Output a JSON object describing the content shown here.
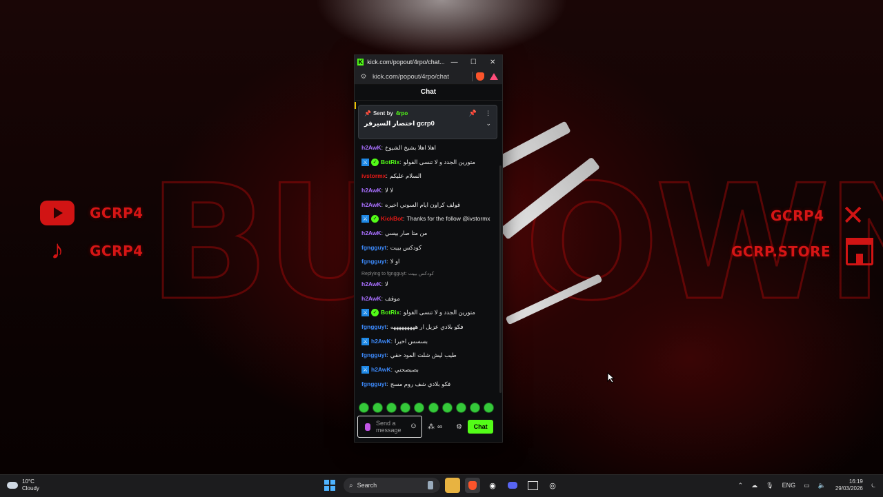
{
  "wallpaper": {
    "social_left": [
      {
        "icon": "youtube-icon",
        "text": "GCRP4"
      },
      {
        "icon": "tiktok-icon",
        "text": "GCRP4"
      }
    ],
    "social_right": [
      {
        "icon": "x-icon",
        "text": "GCRP4"
      },
      {
        "icon": "store-icon",
        "text": "GCRP.STORE"
      }
    ],
    "accent_color": "#d11414"
  },
  "window": {
    "title": "kick.com/popout/4rpo/chat...",
    "url": "kick.com/popout/4rpo/chat",
    "chat_header": "Chat",
    "pinned": {
      "sent_by_label": "Sent by",
      "user": "4rpo",
      "message": "اختصار السيرفر gcrp0"
    },
    "messages": [
      {
        "user": "h2AwK",
        "color": "#a970ff",
        "text": "اهلا اهلا بشيخ الشيوخ",
        "badges": []
      },
      {
        "user": "BotRix",
        "color": "#53fc18",
        "text": "متورين الجدد و لا تنسى الفولو",
        "badges": [
          "mod",
          "verified"
        ]
      },
      {
        "user": "ivstormx",
        "color": "#e91916",
        "text": "السلام عليكم",
        "badges": []
      },
      {
        "user": "h2AwK",
        "color": "#a970ff",
        "text": "لا لا",
        "badges": []
      },
      {
        "user": "h2AwK",
        "color": "#a970ff",
        "text": "قولف كراون ايام السوني اخيره",
        "badges": []
      },
      {
        "user": "KickBot",
        "color": "#e91916",
        "text": "Thanks for the follow @ivstormx",
        "badges": [
          "mod",
          "verified"
        ]
      },
      {
        "user": "h2AwK",
        "color": "#a970ff",
        "text": "من متا صار بيسي",
        "badges": []
      },
      {
        "user": "fgngguyt",
        "color": "#3d8bfd",
        "text": "كودكس بييت",
        "badges": []
      },
      {
        "user": "fgngguyt",
        "color": "#3d8bfd",
        "text": "او لا",
        "badges": []
      },
      {
        "user": "h2AwK",
        "color": "#a970ff",
        "text": "لا",
        "badges": [],
        "reply": "Replying to fgngguyt: كودكس بييت"
      },
      {
        "user": "h2AwK",
        "color": "#a970ff",
        "text": "موقف",
        "badges": []
      },
      {
        "user": "BotRix",
        "color": "#53fc18",
        "text": "متورين الجدد و لا تنسى الفولو",
        "badges": [
          "mod",
          "verified"
        ]
      },
      {
        "user": "fgngguyt",
        "color": "#3d8bfd",
        "text": "فكو بلادي عزيل ار هههههههههه",
        "badges": []
      },
      {
        "user": "h2AwK",
        "color": "#3d8bfd",
        "text": "بسسس اخيرا",
        "badges": [
          "mod"
        ]
      },
      {
        "user": "fgngguyt",
        "color": "#3d8bfd",
        "text": "طيب ليش شلت المود حقي",
        "badges": []
      },
      {
        "user": "h2AwK",
        "color": "#3d8bfd",
        "text": "بصبصحني",
        "badges": [
          "mod"
        ]
      },
      {
        "user": "fgngguyt",
        "color": "#3d8bfd",
        "text": "فكو بلادي شف روم مسج",
        "badges": []
      }
    ],
    "composer": {
      "placeholder": "Send a message",
      "chat_button": "Chat",
      "infinity": "∞"
    }
  },
  "taskbar": {
    "weather_temp": "10°C",
    "weather_desc": "Cloudy",
    "search_label": "Search",
    "language": "ENG",
    "time": "16:19",
    "date": "29/03/2026"
  }
}
